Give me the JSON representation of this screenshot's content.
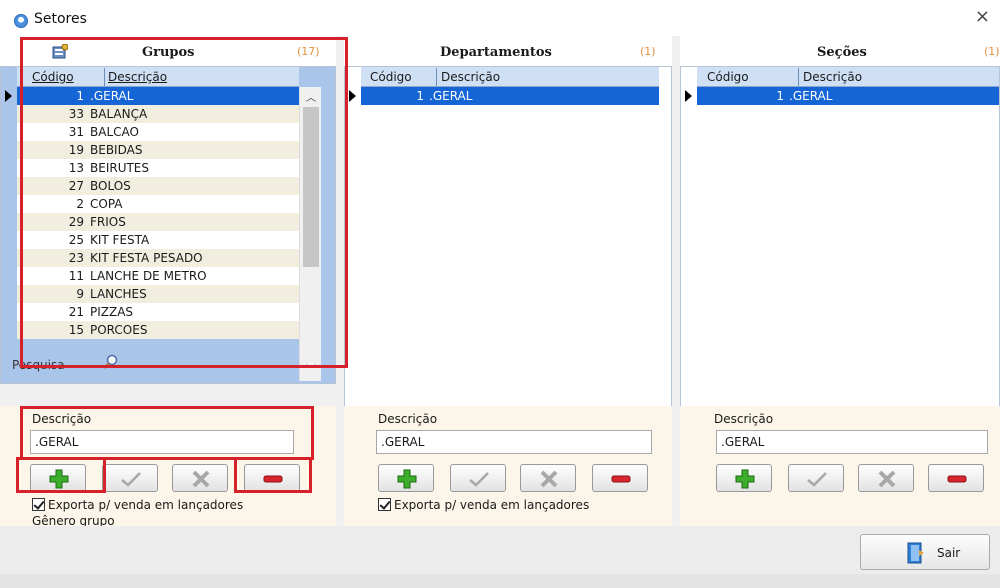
{
  "window": {
    "title": "Setores",
    "close_glyph": "×"
  },
  "grupos": {
    "title": "Grupos",
    "count": "(17)",
    "columns": [
      "Código",
      "Descrição"
    ],
    "rows": [
      {
        "cod": "1",
        "desc": ".GERAL"
      },
      {
        "cod": "33",
        "desc": "BALANÇA"
      },
      {
        "cod": "31",
        "desc": "BALCAO"
      },
      {
        "cod": "19",
        "desc": "BEBIDAS"
      },
      {
        "cod": "13",
        "desc": "BEIRUTES"
      },
      {
        "cod": "27",
        "desc": "BOLOS"
      },
      {
        "cod": "2",
        "desc": "COPA"
      },
      {
        "cod": "29",
        "desc": "FRIOS"
      },
      {
        "cod": "25",
        "desc": "KIT FESTA"
      },
      {
        "cod": "23",
        "desc": "KIT FESTA PESADO"
      },
      {
        "cod": "11",
        "desc": "LANCHE DE METRO"
      },
      {
        "cod": "9",
        "desc": "LANCHES"
      },
      {
        "cod": "21",
        "desc": "PIZZAS"
      },
      {
        "cod": "15",
        "desc": "PORCOES"
      }
    ],
    "search_label": "Pesquisa",
    "field_label": "Descrição",
    "field_value": ".GERAL",
    "export_label": "Exporta p/ venda em lançadores",
    "genero_label": "Gênero grupo"
  },
  "departamentos": {
    "title": "Departamentos",
    "count": "(1)",
    "columns": [
      "Código",
      "Descrição"
    ],
    "rows": [
      {
        "cod": "1",
        "desc": ".GERAL"
      }
    ],
    "field_label": "Descrição",
    "field_value": ".GERAL",
    "export_label": "Exporta p/ venda em lançadores"
  },
  "secoes": {
    "title": "Seções",
    "count": "(1)",
    "columns": [
      "Código",
      "Descrição"
    ],
    "rows": [
      {
        "cod": "1",
        "desc": ".GERAL"
      }
    ],
    "field_label": "Descrição",
    "field_value": ".GERAL"
  },
  "footer": {
    "exit_label": "Sair"
  },
  "colors": {
    "selected_row": "#1565d6",
    "highlight_box": "#d6212a",
    "count_text": "#e0913b"
  },
  "icons": [
    "app-icon",
    "grid-settings-icon",
    "magnifier-icon",
    "add-icon",
    "confirm-icon",
    "cancel-icon",
    "remove-icon",
    "exit-door-icon"
  ]
}
